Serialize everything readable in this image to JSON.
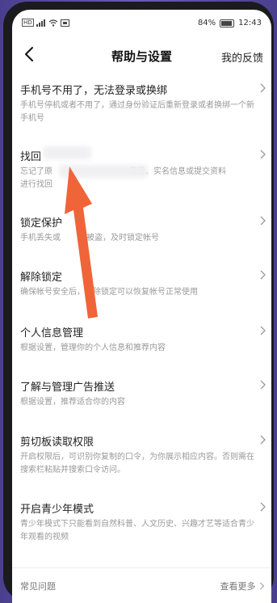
{
  "status": {
    "battery": "84%",
    "time": "12:43",
    "sim_label": "HD"
  },
  "nav": {
    "title": "帮助与设置",
    "feedback": "我的反馈"
  },
  "items": [
    {
      "title": "手机号不用了，无法登录或换绑",
      "desc": "手机号停机或者不用了，通过身份验证后重新登录或者换绑一个新手机号"
    },
    {
      "title": "找回",
      "desc": "忘记了原",
      "desc_tail": "音号、实名信息或提交资料",
      "desc_line2": "进行找回"
    },
    {
      "title": "锁定保护",
      "desc": "手机丢失或",
      "desc_tail": "号被盗，及时锁定帐号"
    },
    {
      "title": "解除锁定",
      "desc": "确保帐号安全后，解除锁定可以恢复帐号正常使用"
    },
    {
      "title": "个人信息管理",
      "desc": "根据设置，管理你的个人信息和推荐内容"
    },
    {
      "title": "了解与管理广告推送",
      "desc": "根据设置，推荐适合你的内容"
    },
    {
      "title": "剪切板读取权限",
      "desc": "开启权限后，可识别你复制的口令，为你展示相应内容。否则需在搜索栏粘贴并搜索口令访问。"
    },
    {
      "title": "开启青少年模式",
      "desc": "青少年模式下只能看到自然科普、人文历史、兴趣才艺等适合青少年观看的视频"
    }
  ],
  "footer": {
    "left": "常见问题",
    "right": "查看更多"
  },
  "colors": {
    "arrow": "#f0643a",
    "background": "#5a4ba0"
  }
}
